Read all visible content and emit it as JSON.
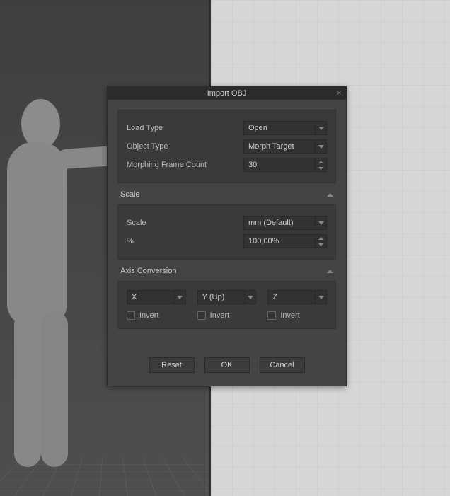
{
  "dialog": {
    "title": "Import OBJ",
    "loadType": {
      "label": "Load Type",
      "value": "Open"
    },
    "objectType": {
      "label": "Object Type",
      "value": "Morph Target"
    },
    "morphFrames": {
      "label": "Morphing Frame Count",
      "value": "30"
    },
    "scale": {
      "header": "Scale",
      "unitLabel": "Scale",
      "unitValue": "mm (Default)",
      "percentLabel": "%",
      "percentValue": "100,00%"
    },
    "axis": {
      "header": "Axis Conversion",
      "x": "X",
      "y": "Y (Up)",
      "z": "Z",
      "invertLabel": "Invert"
    },
    "buttons": {
      "reset": "Reset",
      "ok": "OK",
      "cancel": "Cancel"
    }
  }
}
